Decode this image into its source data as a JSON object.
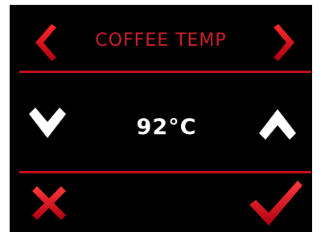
{
  "screen": {
    "title": "COFFEE TEMP",
    "value_display": "92°C",
    "accent_color": "#d01f2f",
    "background_color": "#000000"
  },
  "controls": {
    "prev_icon": "chevron-left-icon",
    "next_icon": "chevron-right-icon",
    "decrease_icon": "chevron-down-icon",
    "increase_icon": "chevron-up-icon",
    "cancel_icon": "cross-icon",
    "confirm_icon": "checkmark-icon"
  }
}
